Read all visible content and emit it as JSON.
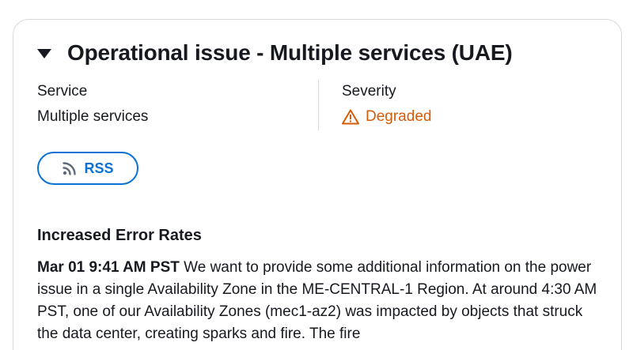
{
  "event": {
    "title": "Operational issue - Multiple services (UAE)",
    "expand_icon": "caret-down-icon"
  },
  "details": {
    "service_label": "Service",
    "service_value": "Multiple services",
    "severity_label": "Severity",
    "severity_value": "Degraded",
    "severity_icon": "warning-icon",
    "severity_color": "#d45b07"
  },
  "rss_button": {
    "label": "RSS",
    "icon": "rss-icon",
    "color": "#0972d3"
  },
  "update": {
    "heading": "Increased Error Rates",
    "timestamp": "Mar 01 9:41 AM PST",
    "text": " We want to provide some additional information on the power issue in a single Availability Zone in the ME-CENTRAL-1 Region. At around 4:30 AM PST, one of our Availability Zones (mec1-az2) was impacted by objects that struck the data center, creating sparks and fire. The fire"
  }
}
